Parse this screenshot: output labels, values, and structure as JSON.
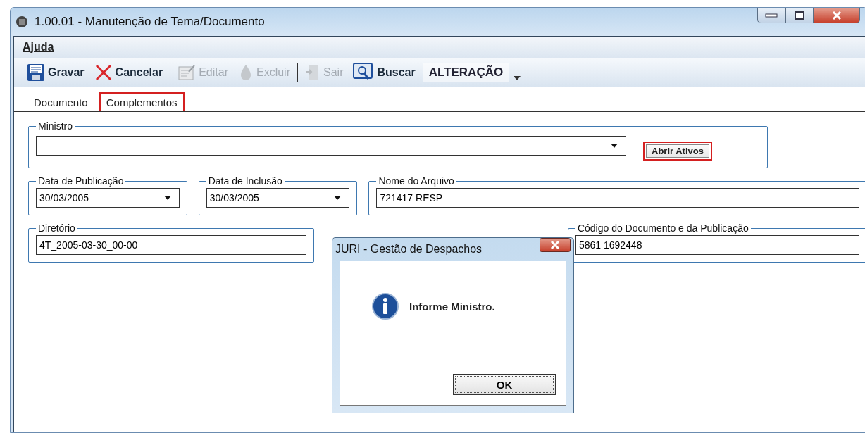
{
  "window": {
    "title": "1.00.01 - Manutenção de Tema/Documento"
  },
  "menu": [
    {
      "label": "Ajuda"
    }
  ],
  "toolbar": [
    {
      "kind": "save",
      "label": "Gravar",
      "disabled": false
    },
    {
      "kind": "cancel",
      "label": "Cancelar",
      "disabled": false
    },
    {
      "kind": "edit",
      "label": "Editar",
      "disabled": true
    },
    {
      "kind": "delete",
      "label": "Excluir",
      "disabled": true
    },
    {
      "kind": "exit",
      "label": "Sair",
      "disabled": true
    },
    {
      "kind": "search",
      "label": "Buscar",
      "disabled": false
    }
  ],
  "mode": {
    "value": "ALTERAÇÃO"
  },
  "tabs": [
    {
      "label": "Documento",
      "selected": false
    },
    {
      "label": "Complementos",
      "selected": true
    }
  ],
  "ministro": {
    "label": "Ministro",
    "button": {
      "label": "Abrir Ativos",
      "highlighted": true
    }
  },
  "fields": [
    {
      "kind": "date",
      "label": "Data de Publicação",
      "value": "30/03/2005"
    },
    {
      "kind": "date",
      "label": "Data de Inclusão",
      "value": "30/03/2005"
    },
    {
      "kind": "text",
      "label": "Nome do Arquivo",
      "value": "721417 RESP"
    },
    {
      "kind": "text",
      "label": "Diretório",
      "value": "4T_2005-03-30_00-00"
    },
    {
      "kind": "text",
      "label": "Código do Documento e da Publicação",
      "value": "5861 1692448"
    }
  ],
  "dialog": {
    "title": "JURI - Gestão de Despachos",
    "message": "Informe Ministro.",
    "button": "OK"
  }
}
